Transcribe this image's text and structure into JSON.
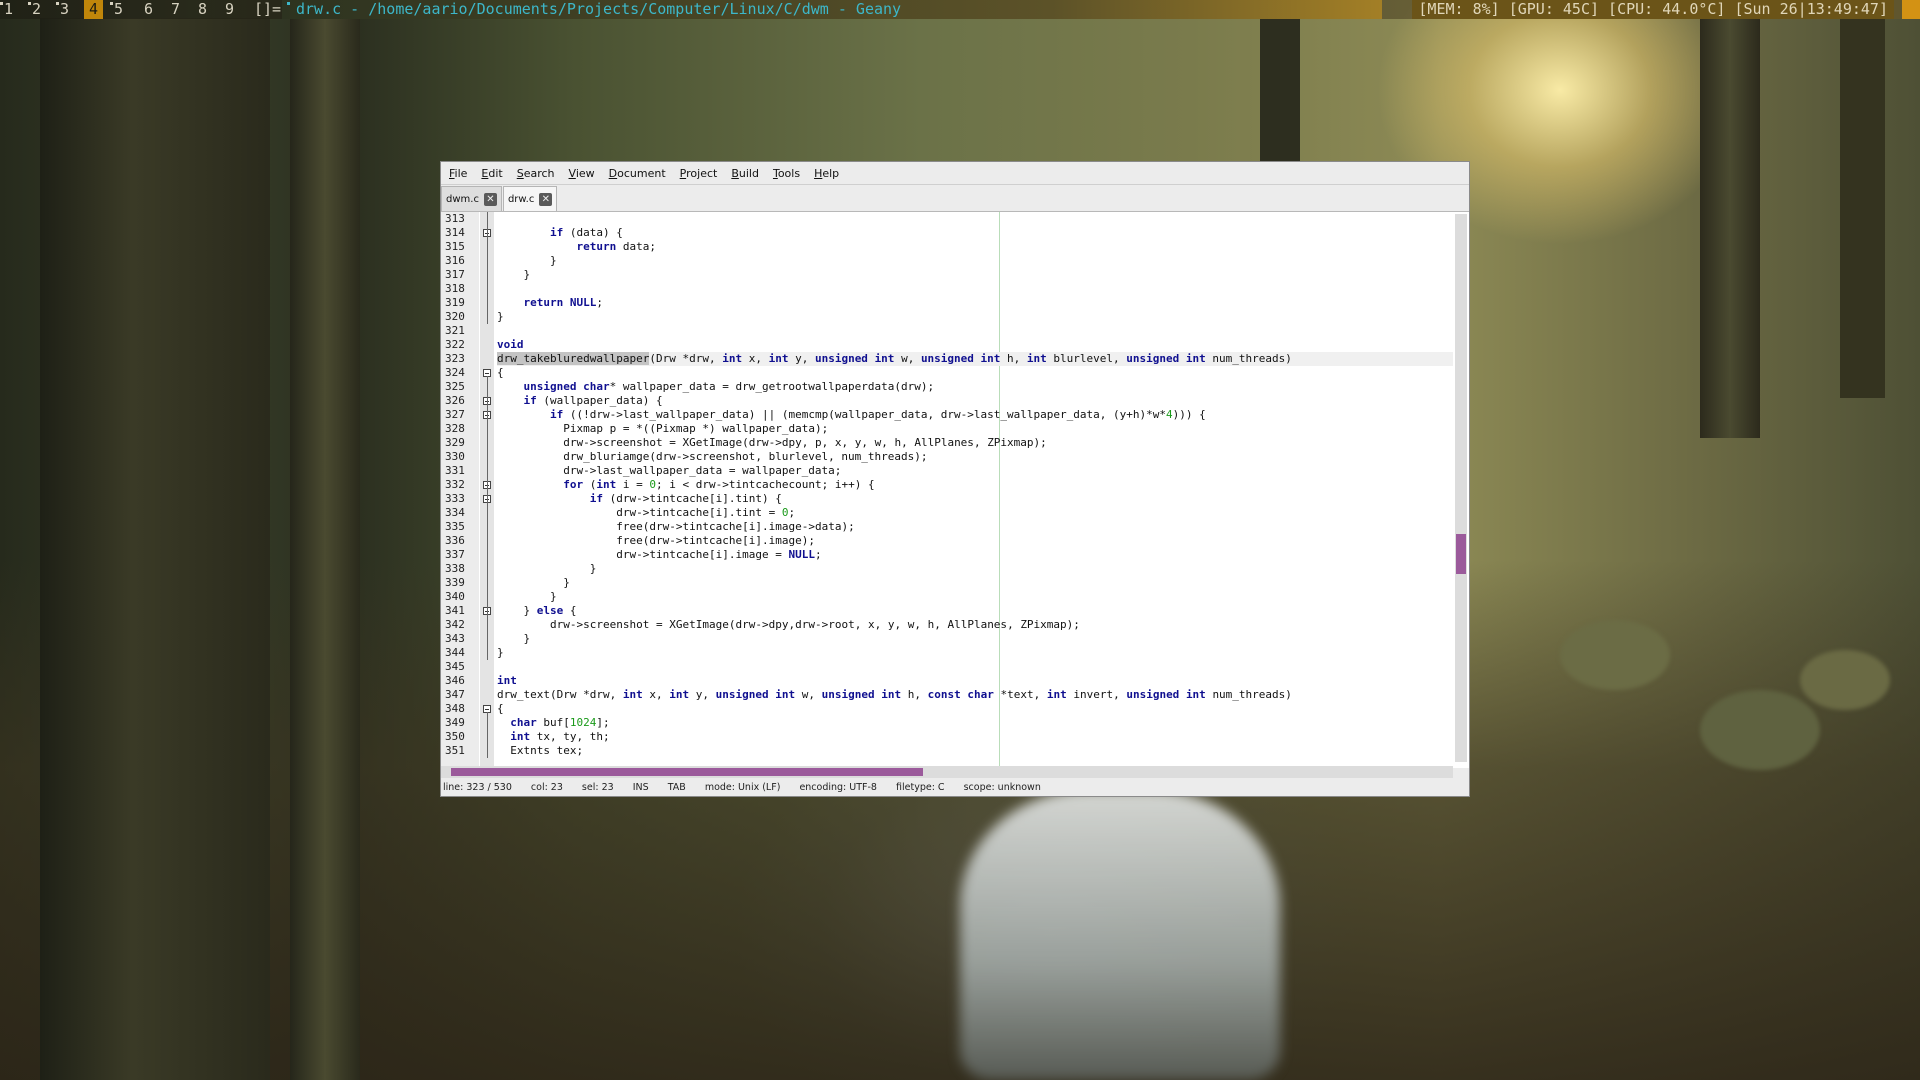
{
  "topbar": {
    "tags": [
      "1",
      "2",
      "3",
      "4",
      "5",
      "6",
      "7",
      "8",
      "9"
    ],
    "active_tag": "4",
    "layout_symbol": "[]=",
    "window_title": "drw.c - /home/aario/Documents/Projects/Computer/Linux/C/dwm - Geany",
    "status_text": "[MEM:  8%] [GPU: 45C] [CPU: 44.0°C] [Sun 26|13:49:47]",
    "accent_color": "#c0860a",
    "title_color": "#3db7c9"
  },
  "menubar": {
    "items": [
      "File",
      "Edit",
      "Search",
      "View",
      "Document",
      "Project",
      "Build",
      "Tools",
      "Help"
    ]
  },
  "tabs": [
    {
      "label": "dwm.c",
      "close_icon": "close-icon"
    },
    {
      "label": "drw.c",
      "close_icon": "close-icon"
    }
  ],
  "editor": {
    "active_tab": "drw.c",
    "current_line": "323",
    "selected_text": "drw_takebluredwallpaper",
    "lines": [
      {
        "n": "313",
        "t": ""
      },
      {
        "n": "314",
        "t": "        if (data) {"
      },
      {
        "n": "315",
        "t": "            return data;"
      },
      {
        "n": "316",
        "t": "        }"
      },
      {
        "n": "317",
        "t": "    }"
      },
      {
        "n": "318",
        "t": ""
      },
      {
        "n": "319",
        "t": "    return NULL;"
      },
      {
        "n": "320",
        "t": "}"
      },
      {
        "n": "321",
        "t": ""
      },
      {
        "n": "322",
        "t": "void"
      },
      {
        "n": "323",
        "t": "drw_takebluredwallpaper(Drw *drw, int x, int y, unsigned int w, unsigned int h, int blurlevel, unsigned int num_threads)"
      },
      {
        "n": "324",
        "t": "{"
      },
      {
        "n": "325",
        "t": "    unsigned char* wallpaper_data = drw_getrootwallpaperdata(drw);"
      },
      {
        "n": "326",
        "t": "    if (wallpaper_data) {"
      },
      {
        "n": "327",
        "t": "        if ((!drw->last_wallpaper_data) || (memcmp(wallpaper_data, drw->last_wallpaper_data, (y+h)*w*4))) {"
      },
      {
        "n": "328",
        "t": "          Pixmap p = *((Pixmap *) wallpaper_data);"
      },
      {
        "n": "329",
        "t": "          drw->screenshot = XGetImage(drw->dpy, p, x, y, w, h, AllPlanes, ZPixmap);"
      },
      {
        "n": "330",
        "t": "          drw_bluriamge(drw->screenshot, blurlevel, num_threads);"
      },
      {
        "n": "331",
        "t": "          drw->last_wallpaper_data = wallpaper_data;"
      },
      {
        "n": "332",
        "t": "          for (int i = 0; i < drw->tintcachecount; i++) {"
      },
      {
        "n": "333",
        "t": "              if (drw->tintcache[i].tint) {"
      },
      {
        "n": "334",
        "t": "                  drw->tintcache[i].tint = 0;"
      },
      {
        "n": "335",
        "t": "                  free(drw->tintcache[i].image->data);"
      },
      {
        "n": "336",
        "t": "                  free(drw->tintcache[i].image);"
      },
      {
        "n": "337",
        "t": "                  drw->tintcache[i].image = NULL;"
      },
      {
        "n": "338",
        "t": "              }"
      },
      {
        "n": "339",
        "t": "          }"
      },
      {
        "n": "340",
        "t": "        }"
      },
      {
        "n": "341",
        "t": "    } else {"
      },
      {
        "n": "342",
        "t": "        drw->screenshot = XGetImage(drw->dpy,drw->root, x, y, w, h, AllPlanes, ZPixmap);"
      },
      {
        "n": "343",
        "t": "    }"
      },
      {
        "n": "344",
        "t": "}"
      },
      {
        "n": "345",
        "t": ""
      },
      {
        "n": "346",
        "t": "int"
      },
      {
        "n": "347",
        "t": "drw_text(Drw *drw, int x, int y, unsigned int w, unsigned int h, const char *text, int invert, unsigned int num_threads)"
      },
      {
        "n": "348",
        "t": "{"
      },
      {
        "n": "349",
        "t": "  char buf[1024];"
      },
      {
        "n": "350",
        "t": "  int tx, ty, th;"
      },
      {
        "n": "351",
        "t": "  Extnts tex;"
      }
    ],
    "keywords": [
      "void",
      "int",
      "unsigned",
      "char",
      "const",
      "if",
      "else",
      "return",
      "for",
      "NULL"
    ]
  },
  "statusbar": {
    "line": "line: 323 / 530",
    "col": "col: 23",
    "sel": "sel: 23",
    "ins": "INS",
    "tab": "TAB",
    "mode": "mode: Unix (LF)",
    "encoding": "encoding: UTF-8",
    "filetype": "filetype: C",
    "scope": "scope: unknown"
  }
}
